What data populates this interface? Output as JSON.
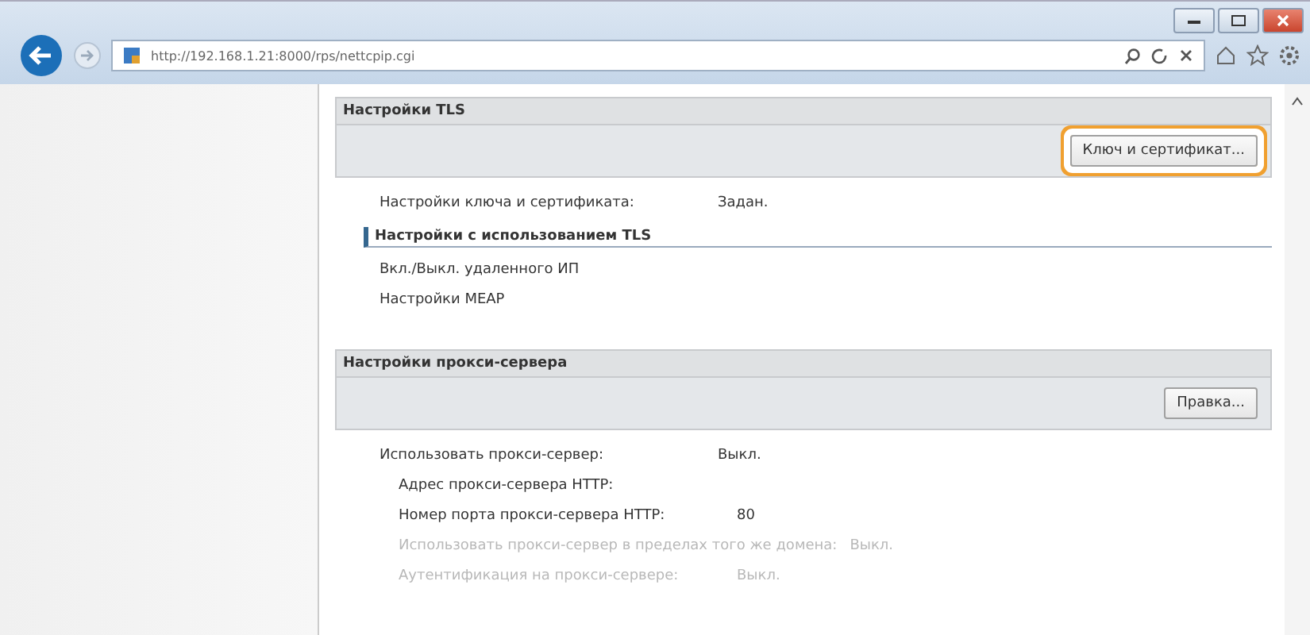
{
  "browser": {
    "address": "http://192.168.1.21:8000/rps/nettcpip.cgi"
  },
  "sections": [
    {
      "title": "Настройки TLS",
      "button": {
        "label": "Ключ и сертификат...",
        "highlighted": true
      },
      "items": [
        {
          "kind": "setting",
          "label": "Настройки ключа и сертификата:",
          "value": "Задан.",
          "disabled": false
        },
        {
          "kind": "subheading",
          "label": "Настройки с использованием TLS"
        },
        {
          "kind": "link",
          "label": "Вкл./Выкл. удаленного ИП"
        },
        {
          "kind": "link",
          "label": "Настройки MEAP"
        }
      ]
    },
    {
      "title": "Настройки прокси-сервера",
      "button": {
        "label": "Правка...",
        "highlighted": false
      },
      "items": [
        {
          "kind": "setting",
          "label": "Использовать прокси-сервер:",
          "value": "Выкл.",
          "disabled": false,
          "children": [
            {
              "kind": "setting",
              "label": "Адрес прокси-сервера HTTP:",
              "disabled": false
            },
            {
              "kind": "setting",
              "label": "Номер порта прокси-сервера HTTP:",
              "value": "80",
              "disabled": false
            },
            {
              "kind": "setting",
              "label": "Использовать прокси-сервер в пределах того же домена:",
              "value": "Выкл.",
              "disabled": true
            },
            {
              "kind": "setting",
              "label": "Аутентификация на прокси-сервере:",
              "value": "Выкл.",
              "disabled": true
            }
          ]
        }
      ]
    }
  ]
}
